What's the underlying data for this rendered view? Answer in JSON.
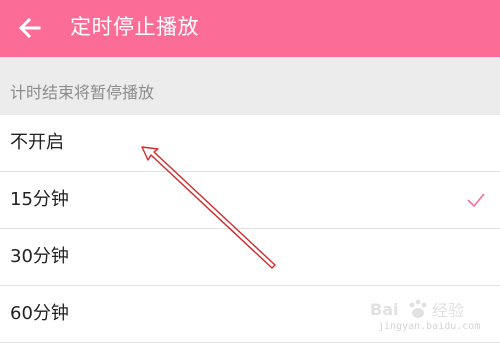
{
  "appbar": {
    "title": "定时停止播放",
    "back_icon": "arrow-left-icon",
    "color": "#fb6c96"
  },
  "section": {
    "header": "计时结束将暂停播放"
  },
  "options": [
    {
      "label": "不开启",
      "selected": false
    },
    {
      "label": "15分钟",
      "selected": true
    },
    {
      "label": "30分钟",
      "selected": false
    },
    {
      "label": "60分钟",
      "selected": false
    }
  ],
  "check_icon": "checkmark-icon",
  "check_color": "#fb6c96",
  "annotation_color": "#d42a2a",
  "watermark": {
    "logo_text": "Bai 经验",
    "url": "jingyan.baidu.com"
  }
}
